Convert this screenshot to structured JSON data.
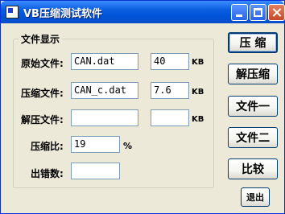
{
  "window": {
    "title": "VB压缩测试软件"
  },
  "group": {
    "legend": "文件显示",
    "rows": [
      {
        "label": "原始文件:",
        "name_value": "CAN.dat",
        "size_value": "40",
        "unit": "KB"
      },
      {
        "label": "压缩文件:",
        "name_value": "CAN_c.dat",
        "size_value": "7.6",
        "unit": "KB"
      },
      {
        "label": "解压文件:",
        "name_value": "",
        "size_value": "",
        "unit": "KB"
      }
    ],
    "ratio": {
      "label": "压缩比:",
      "value": "19",
      "unit": "%"
    },
    "errors": {
      "label": "出错数:",
      "value": ""
    }
  },
  "buttons": {
    "compress": "压 缩",
    "decompress": "解压缩",
    "file1": "文件一",
    "file2": "文件二",
    "compare": "比较",
    "exit": "退出"
  }
}
